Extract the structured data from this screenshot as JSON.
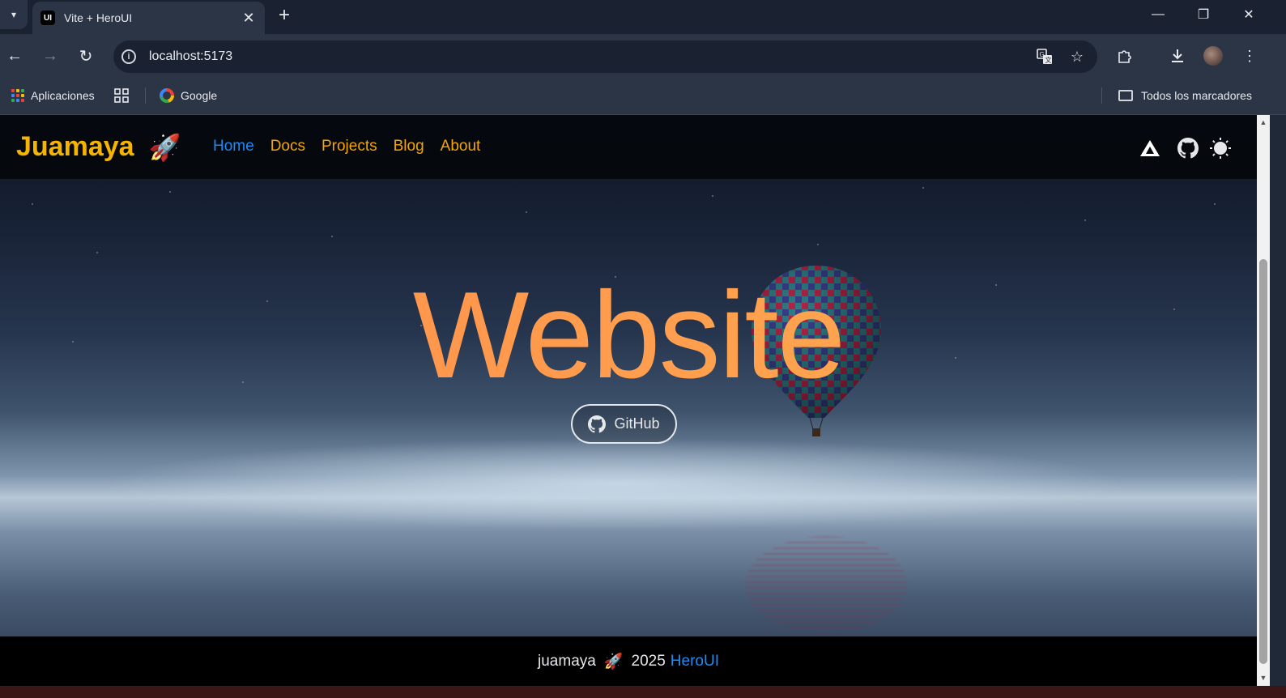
{
  "browser": {
    "tab_title": "Vite + HeroUI",
    "tab_favicon_text": "UI",
    "url": "localhost:5173",
    "bookmarks": {
      "apps_label": "Aplicaciones",
      "google_label": "Google",
      "all_bookmarks_label": "Todos los marcadores"
    }
  },
  "site": {
    "brand": "Juamaya",
    "brand_emoji": "🚀",
    "nav": [
      {
        "label": "Home",
        "active": true
      },
      {
        "label": "Docs",
        "active": false
      },
      {
        "label": "Projects",
        "active": false
      },
      {
        "label": "Blog",
        "active": false
      },
      {
        "label": "About",
        "active": false
      }
    ],
    "hero_title": "Website",
    "github_button": "GitHub",
    "footer": {
      "author": "juamaya",
      "emoji": "🚀",
      "year": "2025",
      "link": "HeroUI"
    }
  },
  "colors": {
    "brand": "#f5b400",
    "nav_link": "#f5a500",
    "nav_active": "#1d8cf8",
    "hero_gradient_start": "#ff8a4c",
    "hero_gradient_end": "#ffb04f"
  }
}
